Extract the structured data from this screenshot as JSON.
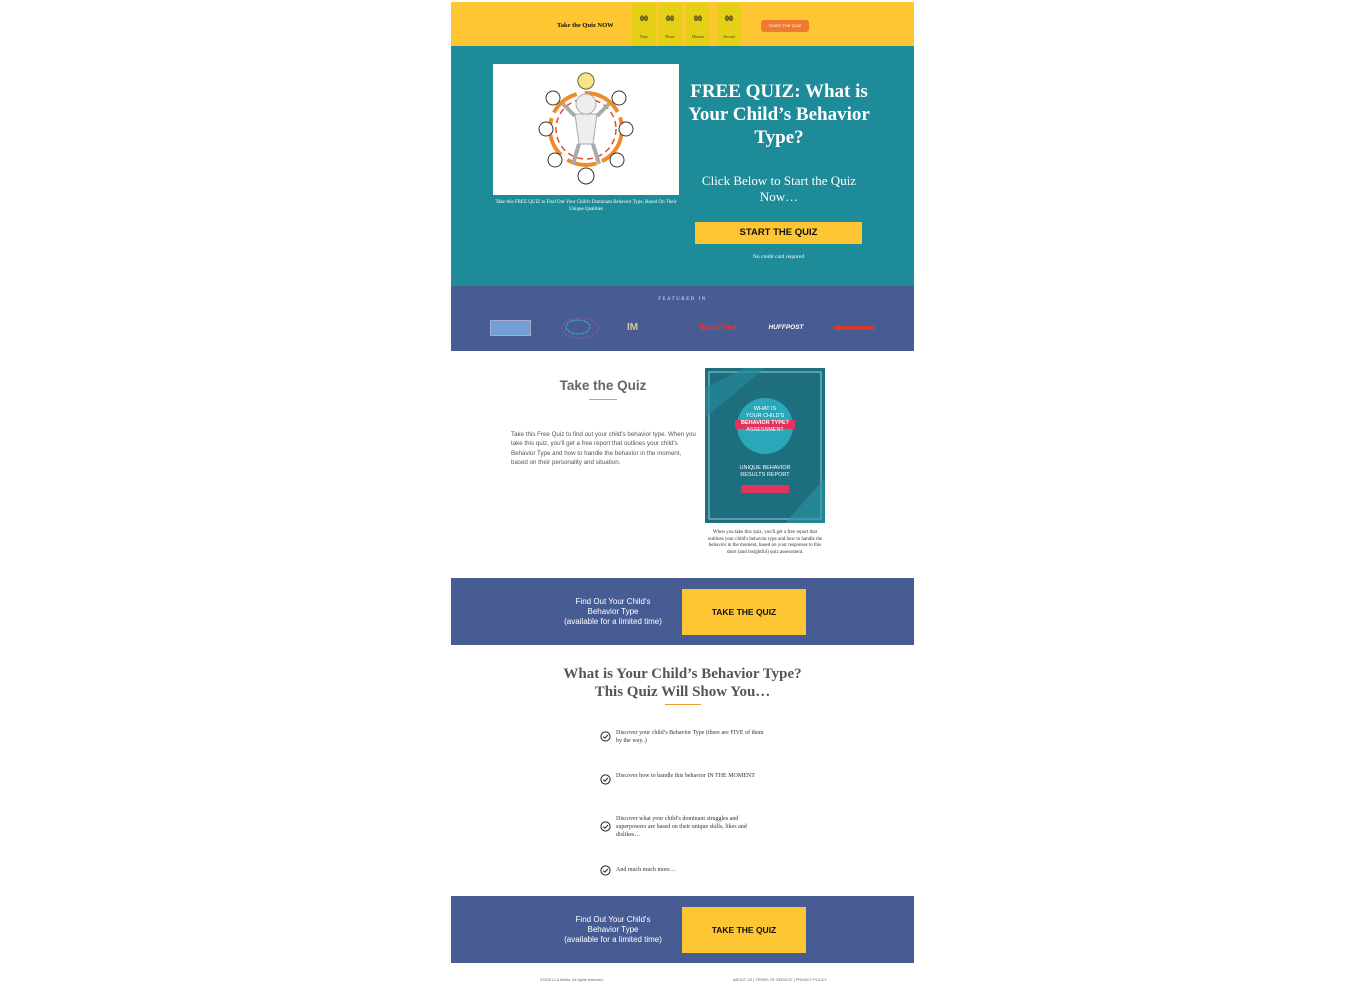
{
  "topbar": {
    "label": "Take the Quiz NOW",
    "countdown": [
      {
        "value": "00",
        "unit": "Days"
      },
      {
        "value": "00",
        "unit": "Hours"
      },
      {
        "value": "00",
        "unit": "Minutes"
      },
      {
        "value": "00",
        "unit": "Second"
      }
    ],
    "button": "START THE QUIZ"
  },
  "hero": {
    "caption": "Take this FREE QUIZ to Find Out Your Child's Dominant Behavior Type, Based On Their Unique Qualities",
    "title": "FREE QUIZ: What is Your Child’s Behavior Type?",
    "subtitle": "Click Below to Start the Quiz Now…",
    "button": "START THE QUIZ",
    "note": "No credit card required"
  },
  "featured": {
    "title": "FEATURED IN",
    "logos": [
      {
        "text": "",
        "icon": "blue-banner-logo"
      },
      {
        "text": "",
        "icon": "brain-network-logo"
      },
      {
        "text": "",
        "icon": "im-logo"
      },
      {
        "text": "BuzzFeed",
        "color": "#e4352a"
      },
      {
        "text": "HUFFPOST",
        "color": "#ffffff"
      },
      {
        "text": "",
        "icon": "red-wordmark-logo"
      }
    ]
  },
  "take_quiz": {
    "title": "Take the Quiz",
    "body": "Take this Free Quiz to find out your child's behavior type. When you take this quiz, you'll get a free report that outlines your child's Behavior Type and how to handle the behavior in the moment, based on their personality and situation.",
    "book": {
      "line1": "WHAT IS",
      "line2": "YOUR CHILD'S",
      "line3": "BEHAVIOR TYPE?",
      "line4": "ASSESSMENT",
      "line5": "UNIQUE BEHAVIOR",
      "line6": "RESULTS REPORT"
    },
    "book_caption": "When you take this quiz, you'll get a free report that outlines your child's behavior type and how to handle the behavior in the moment, based on your responses to this short (and insightful) quiz assessment."
  },
  "cta": {
    "text_line1": "Find Out Your Child's",
    "text_line2": "Behavior Type",
    "text_line3": "(available for a limited time)",
    "button": "TAKE THE QUIZ"
  },
  "what_is": {
    "title_line1": "What is Your Child’s Behavior Type?",
    "title_line2": "This Quiz Will Show You…",
    "bullets": [
      "Discover your child’s Behavior Type (there are FIVE of them by the way..)",
      "Discover how to handle this behavior IN THE MOMENT",
      "Discover what your child’s dominant struggles and superpowers are based on their unique skills, likes and dislikes…",
      "And much much more…"
    ]
  },
  "footer": {
    "copyright": "©2020 LLA Media. All rights reserved.",
    "links": "ABOUT US | TERMS OF SERVICE | PRIVACY POLICY"
  },
  "colors": {
    "yellow": "#fec633",
    "teal": "#1e8b99",
    "navy": "#485c94",
    "orange": "#f27a2f"
  }
}
